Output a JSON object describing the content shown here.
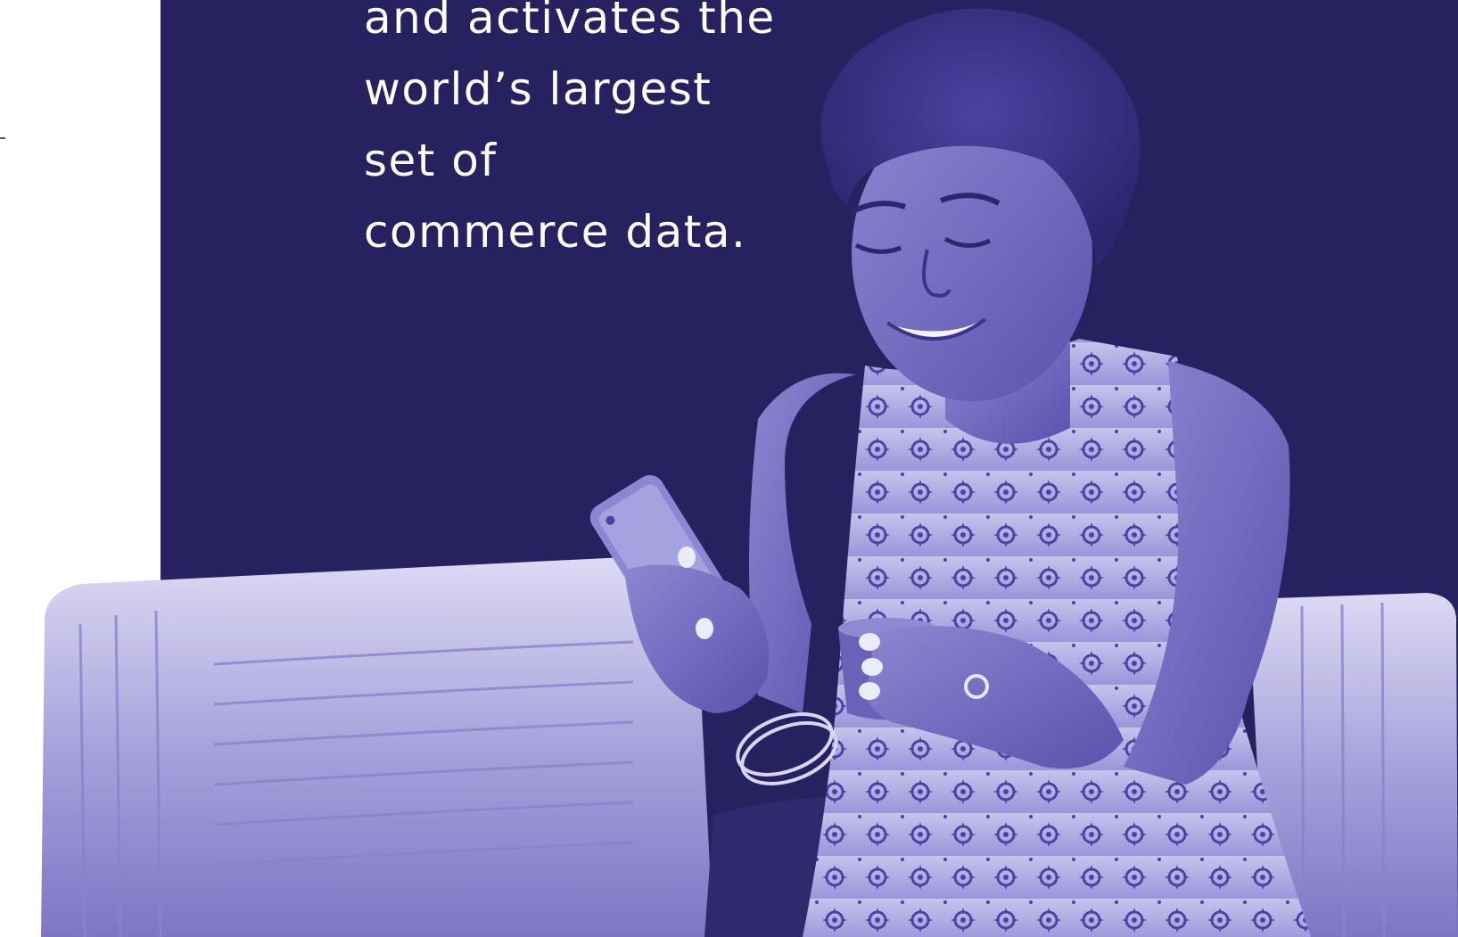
{
  "hero": {
    "headline_lines": [
      "and activates the",
      "world’s largest",
      "set of",
      "commerce data."
    ]
  },
  "photo": {
    "description_icon": "woman-with-phone-on-sofa-photo"
  },
  "colors": {
    "panel": "#27215f",
    "duotone_light": "#c9c6ec",
    "duotone_mid": "#6b63b8",
    "duotone_dark": "#2b2566",
    "text": "#ffffff"
  }
}
